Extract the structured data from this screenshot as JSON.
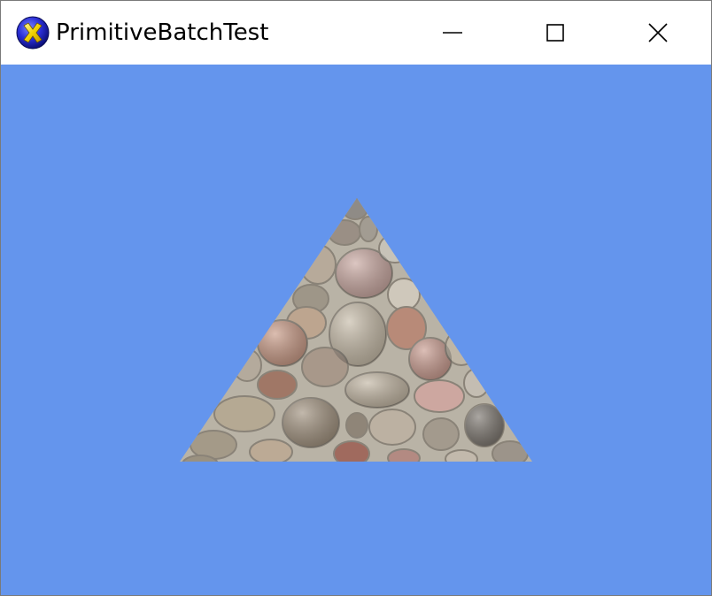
{
  "window": {
    "title": "PrimitiveBatchTest",
    "app_icon": "xna-logo-icon",
    "controls": {
      "minimize_icon": "minimize-icon",
      "maximize_icon": "maximize-icon",
      "close_icon": "close-icon"
    }
  },
  "scene": {
    "background_color": "#6495ED",
    "primitive": "textured-triangle",
    "texture": "stone-wall"
  }
}
